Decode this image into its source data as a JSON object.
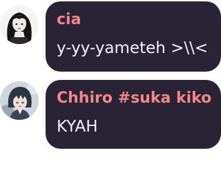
{
  "messages": [
    {
      "author": "cia",
      "text": "y-yy-yameteh >\\\\<",
      "avatar_icon": "avatar-girl-dark-hair-icon"
    },
    {
      "author": "Chhiro #suka kiko",
      "text": "KYAH",
      "avatar_icon": "avatar-anime-boy-icon"
    }
  ],
  "colors": {
    "bubble_bg": "#2a2335",
    "author": "#f3878a",
    "text": "#f4f1f7",
    "page_bg": "#ffffff"
  }
}
